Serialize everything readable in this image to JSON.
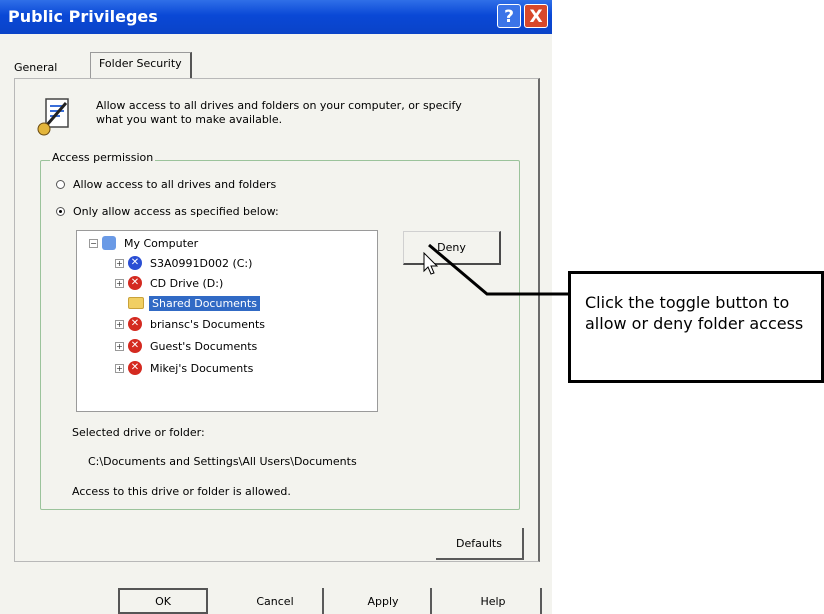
{
  "window": {
    "title": "Public Privileges",
    "help_glyph": "?",
    "close_glyph": "X"
  },
  "tabs": [
    {
      "label": "General"
    },
    {
      "label": "Folder Security",
      "active": true
    }
  ],
  "info": {
    "text": "Allow access to all drives and folders on your computer, or specify what you want to make available."
  },
  "access": {
    "group_label": "Access permission",
    "options": [
      {
        "label": "Allow access to all drives and folders",
        "selected": false
      },
      {
        "label": "Only allow access as specified below:",
        "selected": true
      }
    ]
  },
  "tree": {
    "root": {
      "label": "My Computer",
      "expander": "−",
      "icon": "computer-icon"
    },
    "items": [
      {
        "label": "S3A0991D002 (C:)",
        "expander": "+",
        "icon": "drive-allowed-icon"
      },
      {
        "label": "CD Drive (D:)",
        "expander": "+",
        "icon": "drive-denied-icon"
      },
      {
        "label": "Shared Documents",
        "expander": "",
        "icon": "folder-icon",
        "selected": true
      },
      {
        "label": "briansc's Documents",
        "expander": "+",
        "icon": "folder-denied-icon"
      },
      {
        "label": "Guest's Documents",
        "expander": "+",
        "icon": "folder-denied-icon"
      },
      {
        "label": "Mikej's Documents",
        "expander": "+",
        "icon": "folder-denied-icon"
      }
    ]
  },
  "deny_button": {
    "label": "Deny"
  },
  "selected": {
    "label": "Selected drive or folder:",
    "path": "C:\\Documents and Settings\\All Users\\Documents",
    "status": "Access to this drive or folder is allowed."
  },
  "buttons": {
    "defaults": "Defaults",
    "ok": "OK",
    "cancel": "Cancel",
    "apply": "Apply",
    "help": "Help"
  },
  "callout": {
    "text": "Click the toggle button to allow or deny folder access"
  },
  "colors": {
    "titlebar": "#0a48d6",
    "selection": "#316ac5",
    "deny": "#d42a20",
    "dialog_bg": "#f3f3ee"
  }
}
